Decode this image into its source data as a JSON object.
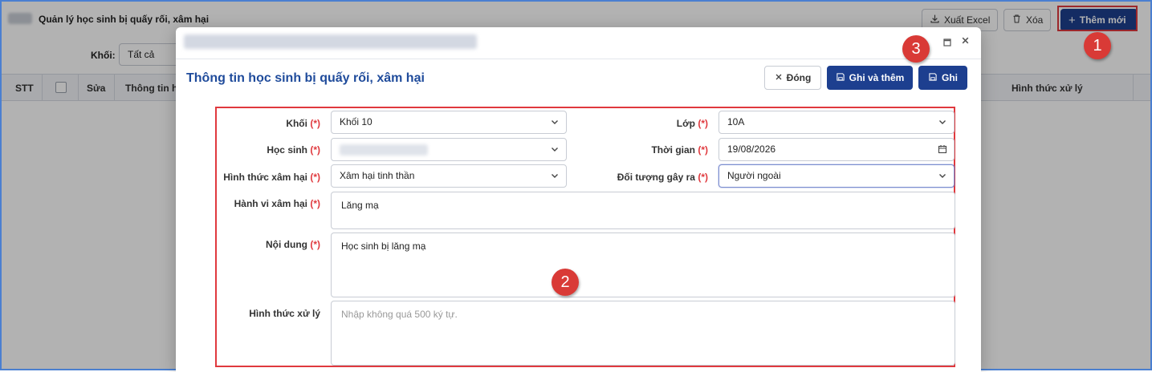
{
  "page": {
    "title": "Quản lý học sinh bị quấy rối, xâm hại",
    "toolbar": {
      "export_label": "Xuất Excel",
      "delete_label": "Xóa",
      "add_label": "Thêm mới"
    },
    "filter": {
      "label": "Khối:",
      "value": "Tất cả"
    },
    "table_headers": [
      "STT",
      "Sửa",
      "Thông tin h",
      "Hình thức xử lý"
    ]
  },
  "annotations": [
    "1",
    "2",
    "3"
  ],
  "modal": {
    "heading": "Thông tin học sinh bị quấy rối, xâm hại",
    "buttons": {
      "close": "Đóng",
      "save_add": "Ghi và thêm",
      "save": "Ghi"
    },
    "required_mark": "(*)",
    "fields": {
      "khoi": {
        "label": "Khối",
        "value": "Khối 10"
      },
      "lop": {
        "label": "Lớp",
        "value": "10A"
      },
      "hoc_sinh": {
        "label": "Học sinh",
        "value": ""
      },
      "thoi_gian": {
        "label": "Thời gian",
        "value": "19/08/2026"
      },
      "hinh_thuc_xam_hai": {
        "label": "Hình thức xâm hại",
        "value": "Xâm hại tinh thần"
      },
      "doi_tuong": {
        "label": "Đối tượng gây ra",
        "value": "Người ngoài"
      },
      "hanh_vi": {
        "label": "Hành vi xâm hại",
        "value": "Lăng mạ"
      },
      "noi_dung": {
        "label": "Nội dung",
        "value": "Học sinh bị lăng mạ"
      },
      "hinh_thuc_xu_ly": {
        "label": "Hình thức xử lý",
        "placeholder": "Nhập không quá 500 ký tự."
      }
    }
  },
  "colors": {
    "primary": "#1d3f8f",
    "heading": "#1f4b9b",
    "required": "#e0393e",
    "annotation": "#d93a36"
  }
}
